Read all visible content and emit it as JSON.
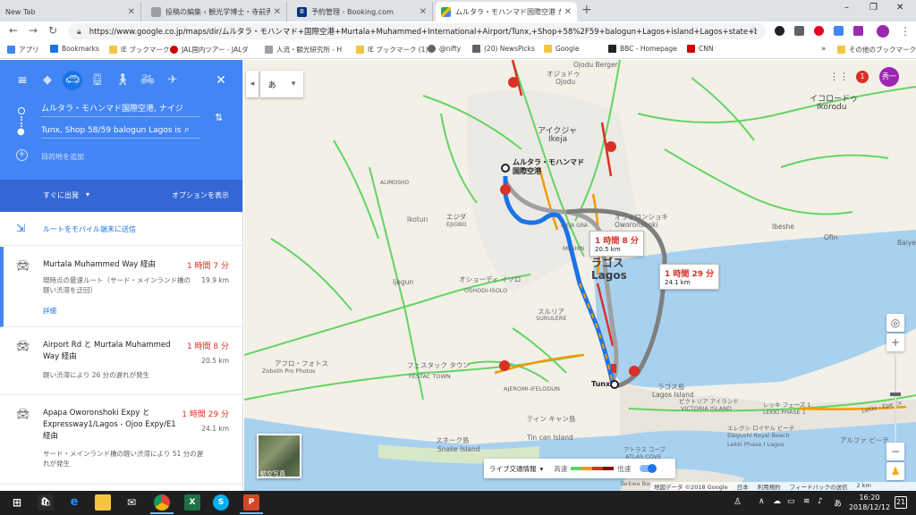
{
  "browser": {
    "tabs": [
      {
        "title": "New Tab"
      },
      {
        "title": "投稿の編集 ‹ 観光学博士・寺前秀"
      },
      {
        "title": "予約管理 - Booking.com"
      },
      {
        "title": "ムルタラ・モハンマド国際空港 から Tu"
      }
    ],
    "new_tab": "+",
    "window_controls": [
      "–",
      "❐",
      "✕"
    ],
    "url": "https://www.google.co.jp/maps/dir/ムルタラ・モハンマド+国際空港+Murtala+Muhammed+International+Airport/Tunx,+Shop+58%2F59+balogun+Lagos+island+Lagos+state+Lag..."
  },
  "bookmarks": [
    {
      "label": "アプリ",
      "color": "#4285f4"
    },
    {
      "label": "Bookmarks",
      "color": "#1a73e8"
    },
    {
      "label": "IE ブックマーク",
      "color": "#f5c542"
    },
    {
      "label": "JAL国内ツアー - JALダ",
      "color": "#cc0000"
    },
    {
      "label": "人流・観光研究所 - H",
      "color": "#9aa0a6"
    },
    {
      "label": "IE ブックマーク (1)",
      "color": "#f5c542"
    },
    {
      "label": "@nifty",
      "color": "#5f6368"
    },
    {
      "label": "(20) NewsPicks",
      "color": "#5f6368"
    },
    {
      "label": "Google",
      "color": "#f5c542"
    },
    {
      "label": "BBC - Homepage",
      "color": "#202124"
    },
    {
      "label": "CNN",
      "color": "#cc0000"
    },
    {
      "label": "その他のブックマーク",
      "color": "#f5c542"
    }
  ],
  "panel": {
    "origin": "ムルタラ・モハンマド国際空港, ナイジ",
    "destination": "Tunx, Shop 58/59 balogun Lagos is",
    "add_destination": "目的地を追加",
    "depart_now": "すぐに出発",
    "options": "オプションを表示",
    "send_to_mobile": "ルートをモバイル端末に送信",
    "routes": [
      {
        "name": "Murtala Muhammed Way 経由",
        "time": "1 時間 7 分",
        "distance": "19.9 km",
        "desc": "現時点の最速ルート（サード・メインランド橋の軽い渋滞を迂回）",
        "details": "詳細"
      },
      {
        "name": "Airport Rd と Murtala Muhammed Way 経由",
        "time": "1 時間 8 分",
        "distance": "20.5 km",
        "desc": "軽い渋滞により 26 分の遅れが発生"
      },
      {
        "name": "Apapa Oworonshoki Expy と Expressway1/Lagos - Ojoo Expy/E1 経由",
        "time": "1 時間 29 分",
        "distance": "24.1 km",
        "desc": "サード・メインランド橋の軽い渋滞により 51 分の遅れが発生"
      }
    ]
  },
  "map": {
    "input_toggle": "あ",
    "avatar": "秀一",
    "notification_count": "1",
    "callouts": [
      {
        "time": "1 時間 8 分",
        "dist": "20.5 km"
      },
      {
        "time": "1 時間 29 分",
        "dist": "24.1 km"
      }
    ],
    "origin_label": "ムルタラ・モハンマド\n国際空港",
    "dest_label": "Tunx",
    "labels": {
      "ojodu_berger": "Ojodu Berger",
      "ojodu_ja": "オジョドゥ",
      "ojodu": "Ojodu",
      "ikeja_ja": "アイクジャ",
      "ikeja": "Ikeja",
      "ikorodu_ja": "イコロードゥ",
      "ikorodu": "Ikorodu",
      "oworonshoki_ja": "オウォロンショキ",
      "oworonshoki": "Oworonshoki",
      "ibeshe": "Ibeshe",
      "ofin": "Ofin",
      "baiye": "Baiye",
      "lagos_ja": "ラゴス",
      "lagos": "Lagos",
      "ikotun": "Ikotun",
      "egbe_ja": "エジダ",
      "ejigbo": "EJIGBO",
      "ijegun": "Ijegun",
      "surulere_ja": "スルリア",
      "surulere": "SURULERE",
      "oshodi_ja": "オショーディ イソロ",
      "oshodi": "OSHODI-ISOLO",
      "festac_ja": "フェスタック タウン",
      "festac": "FESTAC TOWN",
      "ajeromi": "AJEROMI-IFELODUN",
      "lagos_island_ja": "ラゴス島",
      "lagos_island": "Lagos Island",
      "victoria_ja": "ビクトリア アイランド",
      "victoria": "VICTORIA ISLAND",
      "lekki_ja": "レッキ フェーズ 1",
      "lekki": "LEKKI PHASE 1",
      "tincan_ja": "ティン キャン島",
      "tincan": "Tin can Island",
      "snake_ja": "スネーク島",
      "snake": "Snake Island",
      "atlas_ja": "アトラス コーブ",
      "atlas": "ATLAS COVE",
      "eleguishi_ja": "エレグシ ロイヤル ビーチ",
      "eleguishi": "Elegushi Royal Beach",
      "eleguishi2": "Lekki Phase I Lagos",
      "alpha_ja": "アルファ ビーチ",
      "alimosho": "ALIMOSHO",
      "ikeja_gov": "IKEJA GRA",
      "mushin": "MUSHIN",
      "tarkwa": "Tarkwa Bay",
      "otedola": "オショーディ",
      "afrophoto": "アフロ・フォトス",
      "zoboth": "Zoboth Pro Photos",
      "lekki_expy": "Lekki - Epe Ex"
    },
    "satellite": "航空写真",
    "traffic_menu": "ライブ交通情報",
    "traffic_fast": "高速",
    "traffic_slow": "低速",
    "footer": [
      "地図データ ©2018 Google",
      "日本",
      "利用規約",
      "フィードバックの送信",
      "2 km"
    ]
  },
  "taskbar": {
    "time": "16:20",
    "date": "2018/12/12",
    "ime": "あ",
    "notif_count": "21"
  },
  "colors": {
    "accent": "#4285f4",
    "route_blue": "#1a73e8",
    "route_alt": "#a0a0a0",
    "traffic_slow": "#d93025",
    "road_green": "#63d463",
    "road_orange": "#f29900",
    "water": "#a8d1f0"
  }
}
